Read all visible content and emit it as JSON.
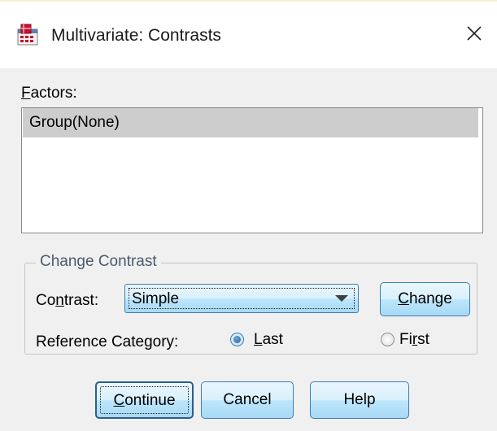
{
  "window": {
    "title": "Multivariate: Contrasts",
    "icon": "spss-dialog-icon",
    "close_icon": "close-icon"
  },
  "factors": {
    "label_first": "F",
    "label_rest": "actors:",
    "items": [
      {
        "label": "Group(None)",
        "selected": true
      }
    ]
  },
  "change_contrast": {
    "legend": "Change Contrast",
    "contrast_label_a": "Co",
    "contrast_label_u": "n",
    "contrast_label_b": "trast:",
    "contrast_value": "Simple",
    "change_u": "C",
    "change_rest": "hange",
    "reference_label": "Reference Category:",
    "last_u": "L",
    "last_rest": "ast",
    "first_a": "Fi",
    "first_u": "r",
    "first_b": "st",
    "reference_selected": "Last"
  },
  "buttons": {
    "continue_u": "C",
    "continue_rest": "ontinue",
    "cancel": "Cancel",
    "help": "Help"
  },
  "colors": {
    "title_bar": "#ffffff",
    "dialog_bg": "#f0f0f0",
    "selection": "#cdcdcd",
    "button_border": "#3c7fb1",
    "legend_text": "#4a5a6e"
  }
}
